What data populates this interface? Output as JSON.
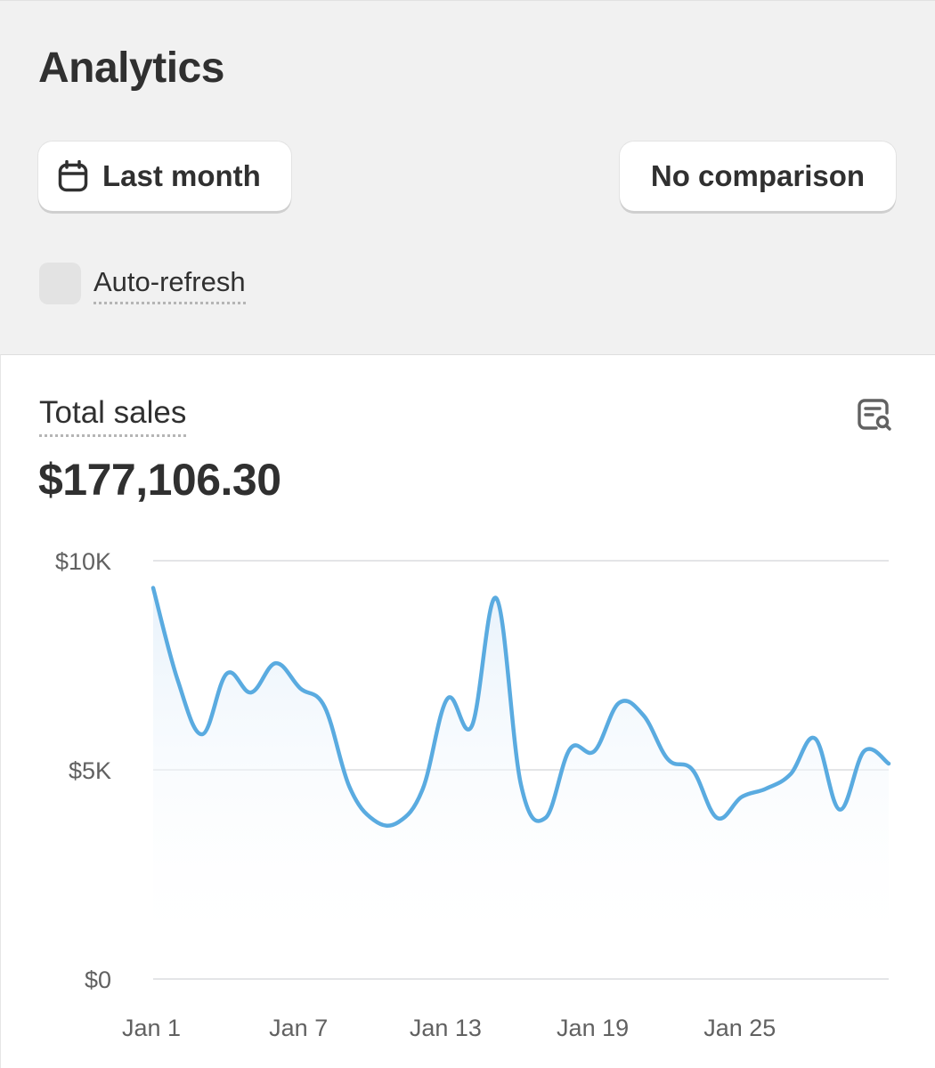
{
  "page": {
    "title": "Analytics"
  },
  "filters": {
    "date_range_label": "Last month",
    "date_range_icon": "calendar-icon",
    "comparison_label": "No comparison",
    "auto_refresh_label": "Auto-refresh",
    "auto_refresh_checked": false
  },
  "card": {
    "metric_label": "Total sales",
    "metric_value": "$177,106.30",
    "action_icon": "explore-data-icon"
  },
  "colors": {
    "line": "#5aabe0",
    "fill_top": "#e9f3fb",
    "grid": "#e4e5e7"
  },
  "chart_data": {
    "type": "area",
    "title": "",
    "xlabel": "",
    "ylabel": "",
    "grid": true,
    "ylim": [
      0,
      10000
    ],
    "y_ticks": [
      {
        "value": 0,
        "label": "$0"
      },
      {
        "value": 5000,
        "label": "$5K"
      },
      {
        "value": 10000,
        "label": "$10K"
      }
    ],
    "x_ticks": [
      {
        "day": 1,
        "label": "Jan 1"
      },
      {
        "day": 7,
        "label": "Jan 7"
      },
      {
        "day": 13,
        "label": "Jan 13"
      },
      {
        "day": 19,
        "label": "Jan 19"
      },
      {
        "day": 25,
        "label": "Jan 25"
      }
    ],
    "x": [
      "Jan 1",
      "Jan 2",
      "Jan 3",
      "Jan 4",
      "Jan 5",
      "Jan 6",
      "Jan 7",
      "Jan 8",
      "Jan 9",
      "Jan 10",
      "Jan 11",
      "Jan 12",
      "Jan 13",
      "Jan 14",
      "Jan 15",
      "Jan 16",
      "Jan 17",
      "Jan 18",
      "Jan 19",
      "Jan 20",
      "Jan 21",
      "Jan 22",
      "Jan 23",
      "Jan 24",
      "Jan 25",
      "Jan 26",
      "Jan 27",
      "Jan 28",
      "Jan 29",
      "Jan 30",
      "Jan 31"
    ],
    "series": [
      {
        "values": [
          9350,
          7150,
          5850,
          7300,
          6850,
          7550,
          6950,
          6500,
          4600,
          3800,
          3750,
          4550,
          6700,
          6050,
          9100,
          4650,
          3850,
          5500,
          5450,
          6600,
          6300,
          5250,
          5000,
          3850,
          4350,
          4550,
          4900,
          5750,
          4050,
          5450,
          5150
        ]
      }
    ]
  }
}
